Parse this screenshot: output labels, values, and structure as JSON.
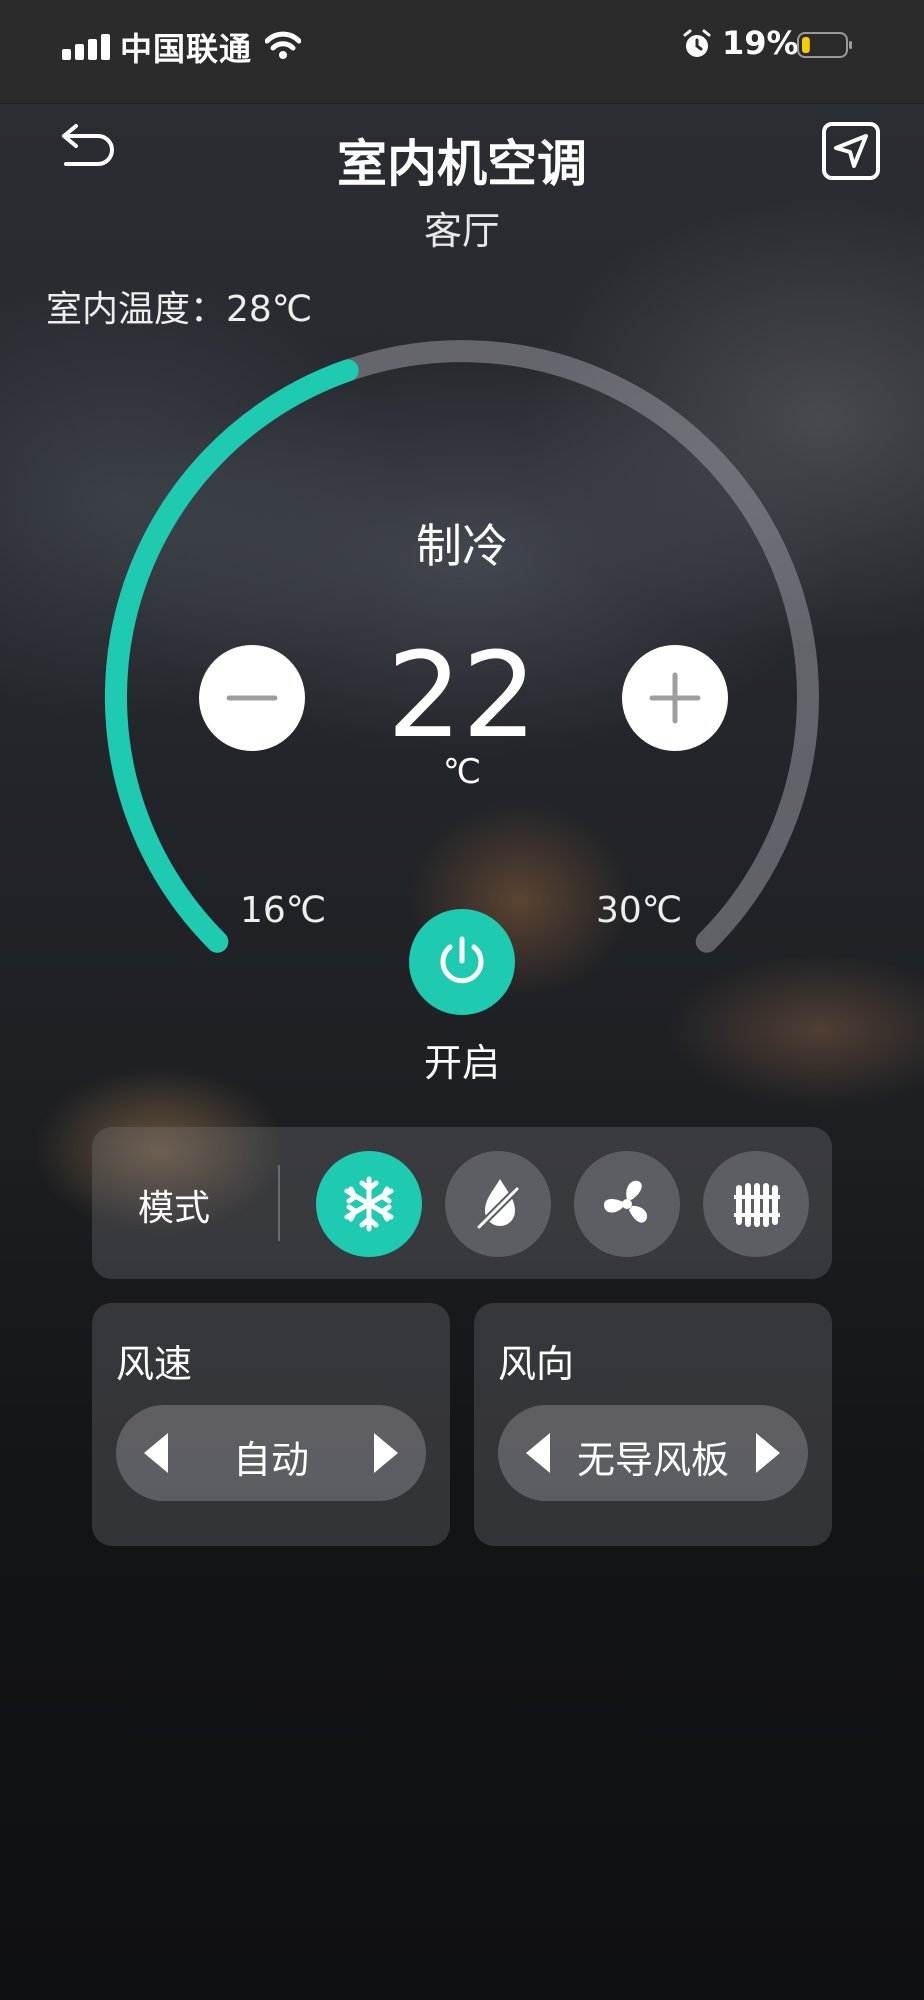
{
  "status_bar": {
    "carrier": "中国联通",
    "battery_percent": "19%",
    "battery_level": 0.19
  },
  "header": {
    "title": "室内机空调",
    "subtitle": "客厅"
  },
  "indoor_temperature": "室内温度：28℃",
  "thermostat": {
    "mode": "制冷",
    "set_temperature": "22",
    "unit": "℃",
    "min_label": "16℃",
    "max_label": "30℃",
    "min_value": 16,
    "max_value": 30,
    "value": 22,
    "accent_color": "#1ecbb0"
  },
  "power": {
    "label": "开启"
  },
  "mode_panel": {
    "label": "模式",
    "options": [
      {
        "icon": "snowflake-icon",
        "active": true
      },
      {
        "icon": "dehumidify-icon",
        "active": false
      },
      {
        "icon": "fan-icon",
        "active": false
      },
      {
        "icon": "heater-icon",
        "active": false
      }
    ]
  },
  "fan_speed": {
    "title": "风速",
    "value": "自动"
  },
  "air_direction": {
    "title": "风向",
    "value": "无导风板"
  }
}
